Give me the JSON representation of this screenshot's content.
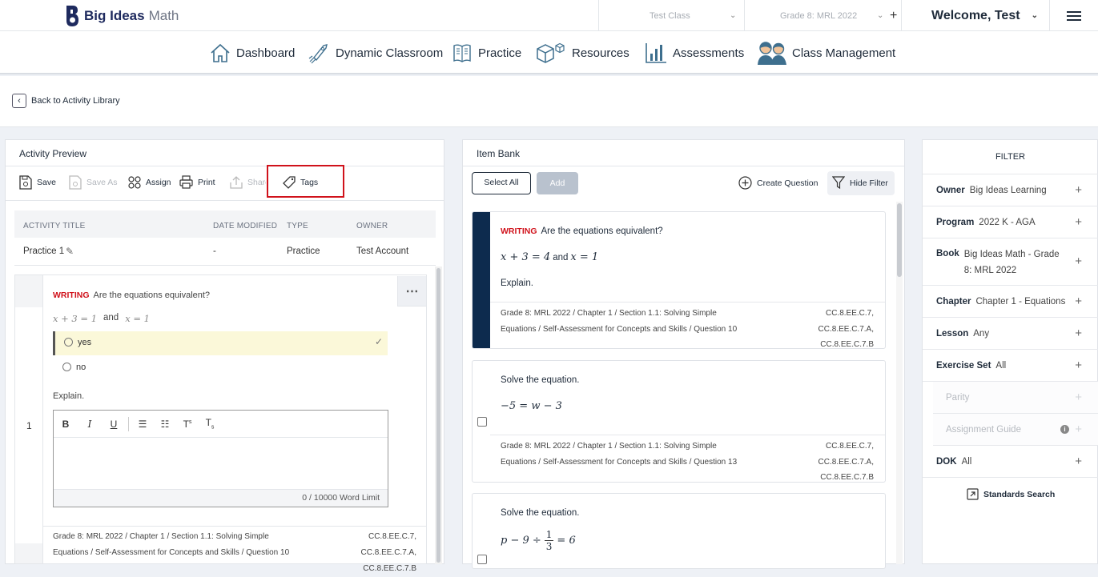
{
  "topbar": {
    "logo_brand": "Big Ideas",
    "logo_suffix": "Math",
    "class_select": "Test Class",
    "grade_select": "Grade 8: MRL 2022",
    "welcome": "Welcome, Test"
  },
  "nav": [
    {
      "label": "Dashboard",
      "icon": "home-icon"
    },
    {
      "label": "Dynamic Classroom",
      "icon": "rocket-icon"
    },
    {
      "label": "Practice",
      "icon": "book-icon"
    },
    {
      "label": "Resources",
      "icon": "boxes-icon"
    },
    {
      "label": "Assessments",
      "icon": "bar-chart-icon"
    },
    {
      "label": "Class Management",
      "icon": "people-icon"
    }
  ],
  "back_link": "Back to Activity Library",
  "preview": {
    "title": "Activity Preview",
    "toolbar": {
      "save": "Save",
      "save_as": "Save As",
      "assign": "Assign",
      "print": "Print",
      "share": "Share",
      "tags": "Tags"
    },
    "table": {
      "headers": [
        "ACTIVITY TITLE",
        "DATE MODIFIED",
        "TYPE",
        "OWNER"
      ],
      "row": [
        "Practice 1",
        "-",
        "Practice",
        "Test Account"
      ]
    },
    "question": {
      "number": "1",
      "tag": "WRITING",
      "prompt": "Are the equations equivalent?",
      "eq_left": "x + 3 = 1",
      "eq_and": "and",
      "eq_right": "x = 1",
      "options": [
        "yes",
        "no"
      ],
      "explain": "Explain.",
      "word_limit": "0  / 10000 Word Limit",
      "meta_left": [
        "Grade 8: MRL 2022 / Chapter 1 / Section 1.1: Solving Simple",
        "Equations / Self-Assessment for Concepts and Skills / Question 10"
      ],
      "meta_right": [
        "CC.8.EE.C.7,",
        "CC.8.EE.C.7.A,",
        "CC.8.EE.C.7.B"
      ]
    }
  },
  "bank": {
    "title": "Item Bank",
    "select_all": "Select All",
    "add": "Add",
    "create_question": "Create Question",
    "hide_filter": "Hide Filter",
    "items": [
      {
        "tag": "WRITING",
        "prompt": "Are the equations equivalent?",
        "eq": "x + 3 = 4",
        "eq_and": "and",
        "eq2": "x = 1",
        "explain": "Explain.",
        "meta_left": [
          "Grade 8: MRL 2022 / Chapter 1 / Section 1.1: Solving Simple",
          "Equations / Self-Assessment for Concepts and Skills / Question 10"
        ],
        "meta_right": [
          "CC.8.EE.C.7,",
          "CC.8.EE.C.7.A,",
          "CC.8.EE.C.7.B"
        ]
      },
      {
        "prompt": "Solve the equation.",
        "eq": "−5 = w − 3",
        "meta_left": [
          "Grade 8: MRL 2022 / Chapter 1 / Section 1.1: Solving Simple",
          "Equations / Self-Assessment for Concepts and Skills / Question 13"
        ],
        "meta_right": [
          "CC.8.EE.C.7,",
          "CC.8.EE.C.7.A,",
          "CC.8.EE.C.7.B"
        ]
      },
      {
        "prompt": "Solve the equation.",
        "eq_left": "p − 9 ÷",
        "frac_num": "1",
        "frac_den": "3",
        "eq_right": "= 6"
      }
    ]
  },
  "filter": {
    "title": "FILTER",
    "items": [
      {
        "key": "Owner",
        "value": "Big Ideas Learning"
      },
      {
        "key": "Program",
        "value": "2022 K - AGA"
      },
      {
        "key": "Book",
        "value": "Big Ideas Math - Grade 8: MRL 2022"
      },
      {
        "key": "Chapter",
        "value": "Chapter 1 - Equations"
      },
      {
        "key": "Lesson",
        "value": "Any"
      },
      {
        "key": "Exercise Set",
        "value": "All"
      }
    ],
    "sub_items": [
      "Parity",
      "Assignment Guide"
    ],
    "dok": {
      "key": "DOK",
      "value": "All"
    },
    "standards_search": "Standards Search"
  },
  "colors": {
    "accent_red": "#d0121b",
    "navy": "#0d2b4e",
    "selected_answer": "#fbf8d9"
  }
}
